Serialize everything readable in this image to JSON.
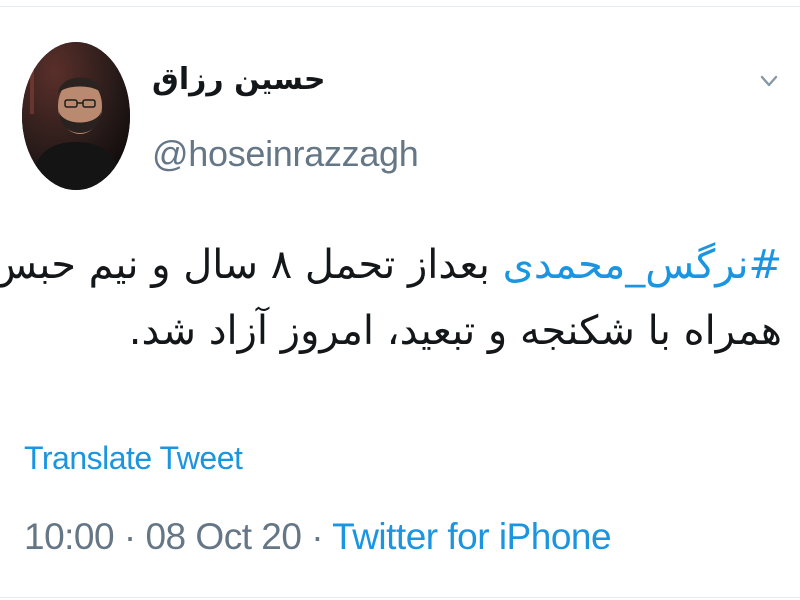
{
  "tweet": {
    "author": {
      "display_name": "حسین رزاق",
      "handle": "@hoseinrazzagh"
    },
    "menu_icon": "chevron-down-icon",
    "text": {
      "hashtag": "#نرگس_محمدی",
      "line1_rest": " بعداز تحمل ۸ سال و نیم حبس",
      "line2": "همراه با شکنجه و تبعید، امروز آزاد شد."
    },
    "translate_label": "Translate Tweet",
    "time": "10:00",
    "separator": " · ",
    "date": "08 Oct 20",
    "source": "Twitter for iPhone"
  },
  "colors": {
    "link": "#1b95e0",
    "text": "#14171a",
    "muted": "#657786",
    "divider": "#e6ecf0"
  }
}
